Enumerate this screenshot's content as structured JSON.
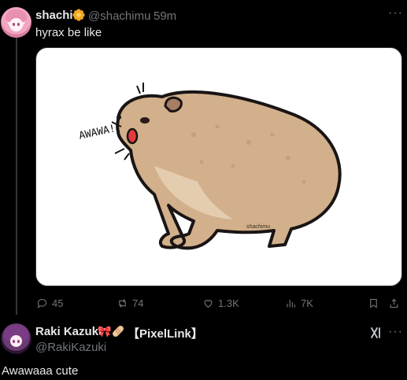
{
  "post": {
    "author": {
      "name": "shachi",
      "handle": "@shachimu",
      "time": "59m"
    },
    "separator": "·",
    "text": "hyrax be like",
    "image": {
      "sound_text": "AWAWA!",
      "signature": "shachimu"
    },
    "stats": {
      "replies": "45",
      "reposts": "74",
      "likes": "1.3K",
      "views": "7K"
    }
  },
  "reply": {
    "author": {
      "name": "Raki Kazuki",
      "tag": "【PixelLink】",
      "handle": "@RakiKazuki"
    },
    "emoji_bow": "🎀",
    "text": "Awawaaa cute"
  },
  "ui": {
    "more": "···"
  },
  "icons": [
    "flower-badge-icon",
    "more-icon",
    "reply-icon",
    "repost-icon",
    "like-icon",
    "views-icon",
    "bookmark-icon",
    "share-icon",
    "bow-emoji",
    "bandage-emoji",
    "grok-icon"
  ],
  "colors": {
    "background": "#000000",
    "text": "#e7e9ea",
    "muted": "#71767b",
    "badge": "#f4a623",
    "hyrax_body": "#d1b08b",
    "bow": "#e0245e"
  }
}
